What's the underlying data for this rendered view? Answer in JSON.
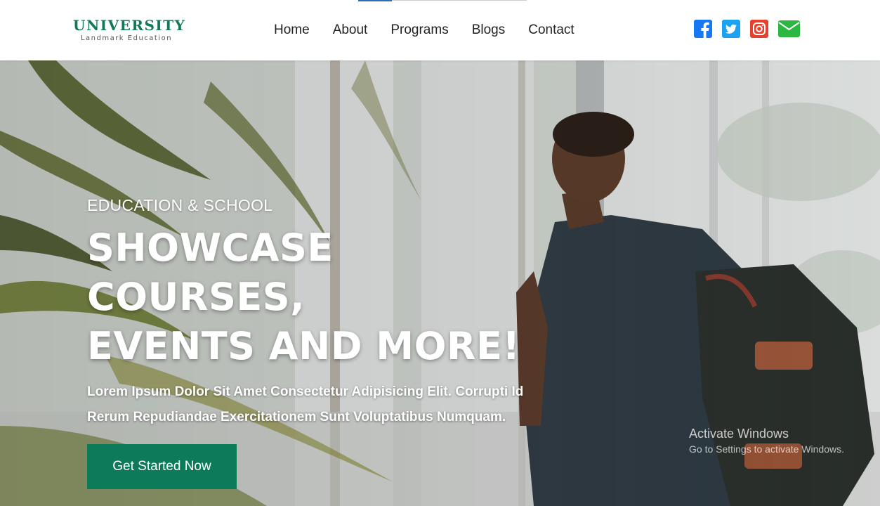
{
  "brand": {
    "title": "UNIVERSITY",
    "subtitle": "Landmark Education",
    "color": "#117a55"
  },
  "nav": {
    "items": [
      "Home",
      "About",
      "Programs",
      "Blogs",
      "Contact"
    ]
  },
  "socials": [
    {
      "icon": "facebook-icon",
      "color": "#1877f2"
    },
    {
      "icon": "twitter-icon",
      "color": "#1da1f2"
    },
    {
      "icon": "instagram-icon",
      "color": "#e1306c"
    },
    {
      "icon": "envelope-icon",
      "color": "#2cb742"
    }
  ],
  "hero": {
    "eyebrow": "EDUCATION & SCHOOL",
    "headline_line1": "SHOWCASE COURSES,",
    "headline_line2": "EVENTS AND MORE!",
    "description": "Lorem Ipsum Dolor Sit Amet Consectetur Adipisicing Elit. Corrupti Id Rerum Repudiandae Exercitationem Sunt Voluptatibus Numquam.",
    "cta_label": "Get Started Now",
    "cta_color": "#0d7a5a"
  },
  "os_watermark": {
    "line1": "Activate Windows",
    "line2": "Go to Settings to activate Windows."
  }
}
